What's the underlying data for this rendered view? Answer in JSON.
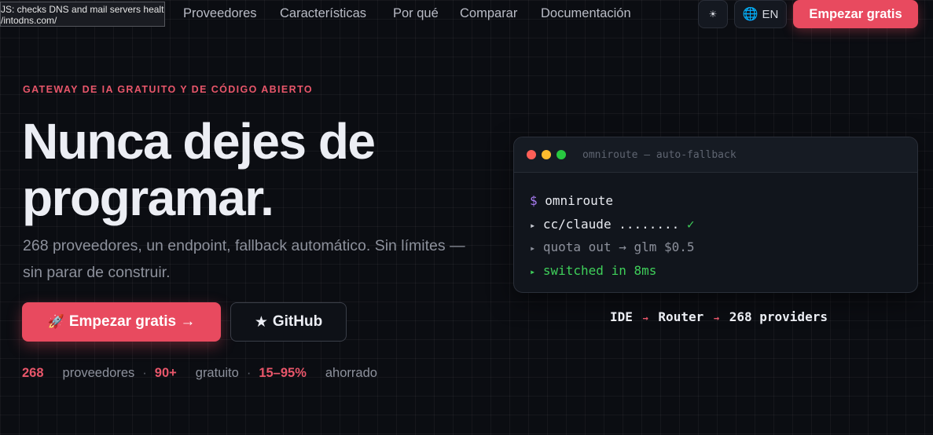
{
  "tooltip": {
    "line1": "JS: checks DNS and mail servers health",
    "line2": "/intodns.com/"
  },
  "nav": {
    "links": [
      "Proveedores",
      "Características",
      "Por qué",
      "Comparar",
      "Documentación"
    ],
    "theme_icon": "sun-icon",
    "theme_glyph": "☀",
    "lang_icon": "globe-icon",
    "lang_glyph": "🌐",
    "lang_label": "EN",
    "cta_label": "Empezar gratis"
  },
  "hero": {
    "eyebrow": "GATEWAY DE IA GRATUITO Y DE CÓDIGO ABIERTO",
    "headline_line1": "Nunca dejes de",
    "headline_line2": "programar.",
    "subtitle": "268 proveedores, un endpoint, fallback automático. Sin límites — sin parar de construir.",
    "primary_button": {
      "icon": "rocket-icon",
      "glyph": "🚀",
      "label": "Empezar gratis →"
    },
    "secondary_button": {
      "icon": "star-icon",
      "glyph": "★",
      "label": "GitHub"
    },
    "stats": [
      {
        "value": "268",
        "label": "proveedores"
      },
      {
        "value": "90+",
        "label": "gratuito"
      },
      {
        "value": "15–95%",
        "label": "ahorrado"
      }
    ],
    "stat_separator": "·"
  },
  "terminal": {
    "title": "omniroute — auto-fallback",
    "prompt": "$",
    "command": "omniroute",
    "line2_marker": "▸",
    "line2_text": "cc/claude ........",
    "line2_check": "✓",
    "line3_marker": "▸",
    "line3_text": "quota out → glm $0.5",
    "line4_marker": "▸",
    "line4_text": "switched in 8ms"
  },
  "flow": {
    "items": [
      "IDE",
      "Router",
      "268 providers"
    ],
    "arrow": "→"
  },
  "colors": {
    "accent": "#e84a5f",
    "background": "#0b0d12",
    "terminal_prompt": "#a77bf0",
    "terminal_success": "#3fcf5a",
    "dot_red": "#ff5f57",
    "dot_yellow": "#febc2e",
    "dot_green": "#28c840"
  }
}
